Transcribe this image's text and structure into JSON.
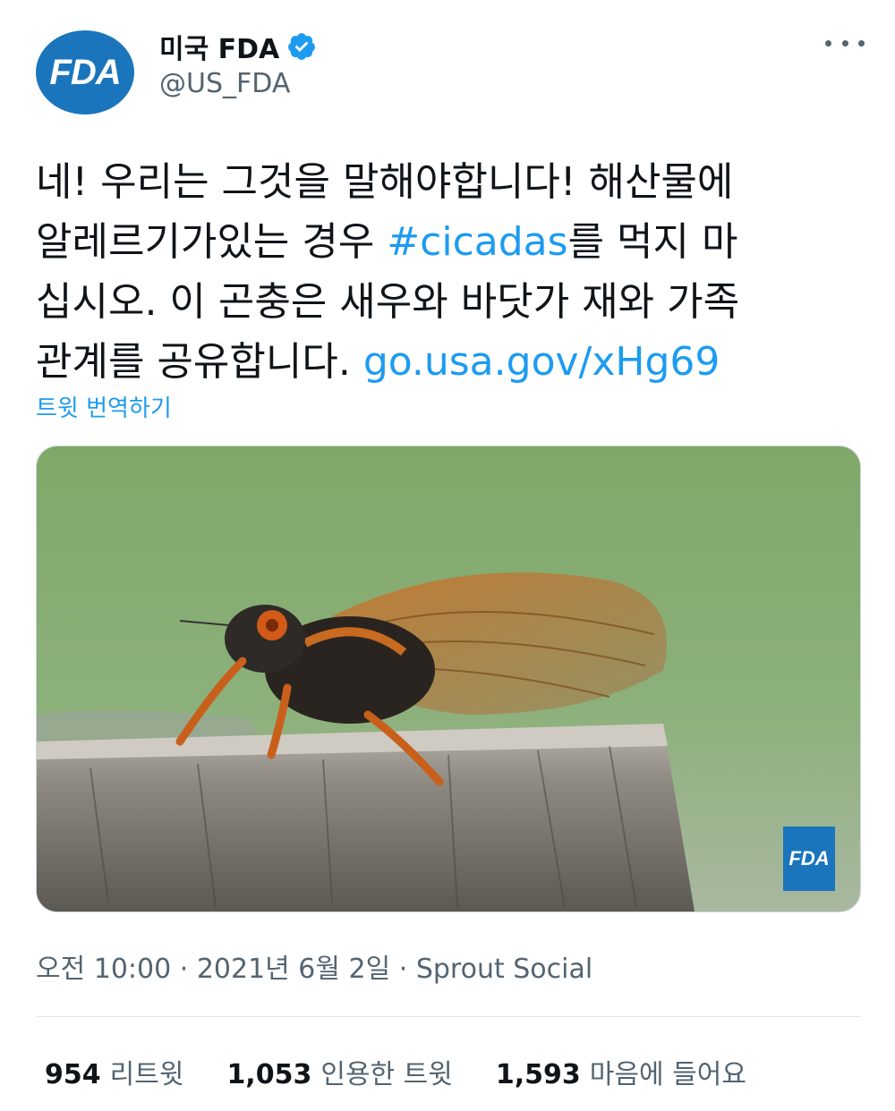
{
  "author": {
    "avatar_text": "FDA",
    "display_name": "미국 FDA",
    "handle": "@US_FDA",
    "verified_icon": "verified-badge-icon"
  },
  "tweet": {
    "line1": "네! 우리는 그것을 말해야합니다! 해산물에",
    "line2_a": "알레르기가있는 경우 ",
    "line2_hashtag": "#cicadas",
    "line2_b": "를 먹지 마",
    "line3": "십시오. 이 곤충은 새우와 바닷가 재와 가족",
    "line4_a": "관계를 공유합니다.  ",
    "line4_link": "go.usa.gov/xHg69",
    "translate_label": "트윗 번역하기"
  },
  "media": {
    "watermark": "FDA"
  },
  "meta": {
    "time": "오전 10:00",
    "sep1": " · ",
    "date": "2021년 6월 2일",
    "sep2": " · ",
    "source": "Sprout Social"
  },
  "stats": {
    "retweets_count": "954",
    "retweets_label": "리트윗",
    "quotes_count": "1,053",
    "quotes_label": "인용한 트윗",
    "likes_count": "1,593",
    "likes_label": "마음에 들어요"
  },
  "colors": {
    "accent": "#1d9bf0",
    "brand": "#1a75bc",
    "muted": "#536471"
  }
}
